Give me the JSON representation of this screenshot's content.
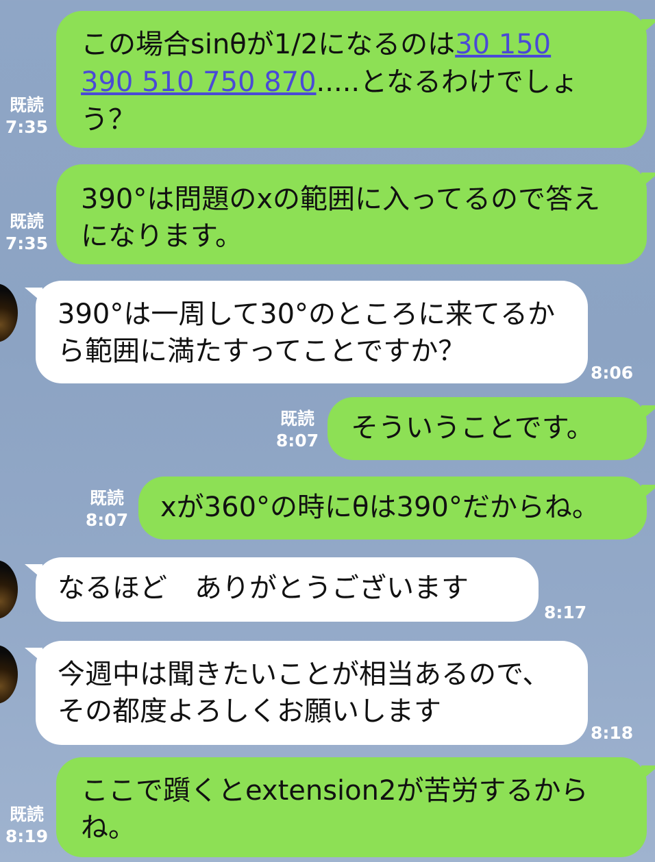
{
  "messages": [
    {
      "direction": "outgoing",
      "read_label": "既読",
      "time": "7:35",
      "text_before": "この場合sinθが1/2になるのは",
      "link_text_1": "30 150",
      "link_text_2": "390 510 750 870",
      "text_after": ".....となるわけでしょう？"
    },
    {
      "direction": "outgoing",
      "read_label": "既読",
      "time": "7:35",
      "text": "390°は問題のxの範囲に入ってるので答えになります。"
    },
    {
      "direction": "incoming",
      "time": "8:06",
      "text": "390°は一周して30°のところに来てるから範囲に満たすってことですか？"
    },
    {
      "direction": "outgoing",
      "read_label": "既読",
      "time": "8:07",
      "text": "そういうことです。"
    },
    {
      "direction": "outgoing",
      "read_label": "既読",
      "time": "8:07",
      "text": "xが360°の時にθは390°だからね。"
    },
    {
      "direction": "incoming",
      "time": "8:17",
      "text": "なるほど　ありがとうございます"
    },
    {
      "direction": "incoming",
      "time": "8:18",
      "text": "今週中は聞きたいことが相当あるので、その都度よろしくお願いします"
    },
    {
      "direction": "outgoing",
      "read_label": "既読",
      "time": "8:19",
      "text": "ここで躓くとextension2が苦労するからね。"
    }
  ],
  "colors": {
    "background": "#8fa6c6",
    "outgoing_bubble": "#8de055",
    "incoming_bubble": "#ffffff",
    "link": "#4a4ad6"
  }
}
